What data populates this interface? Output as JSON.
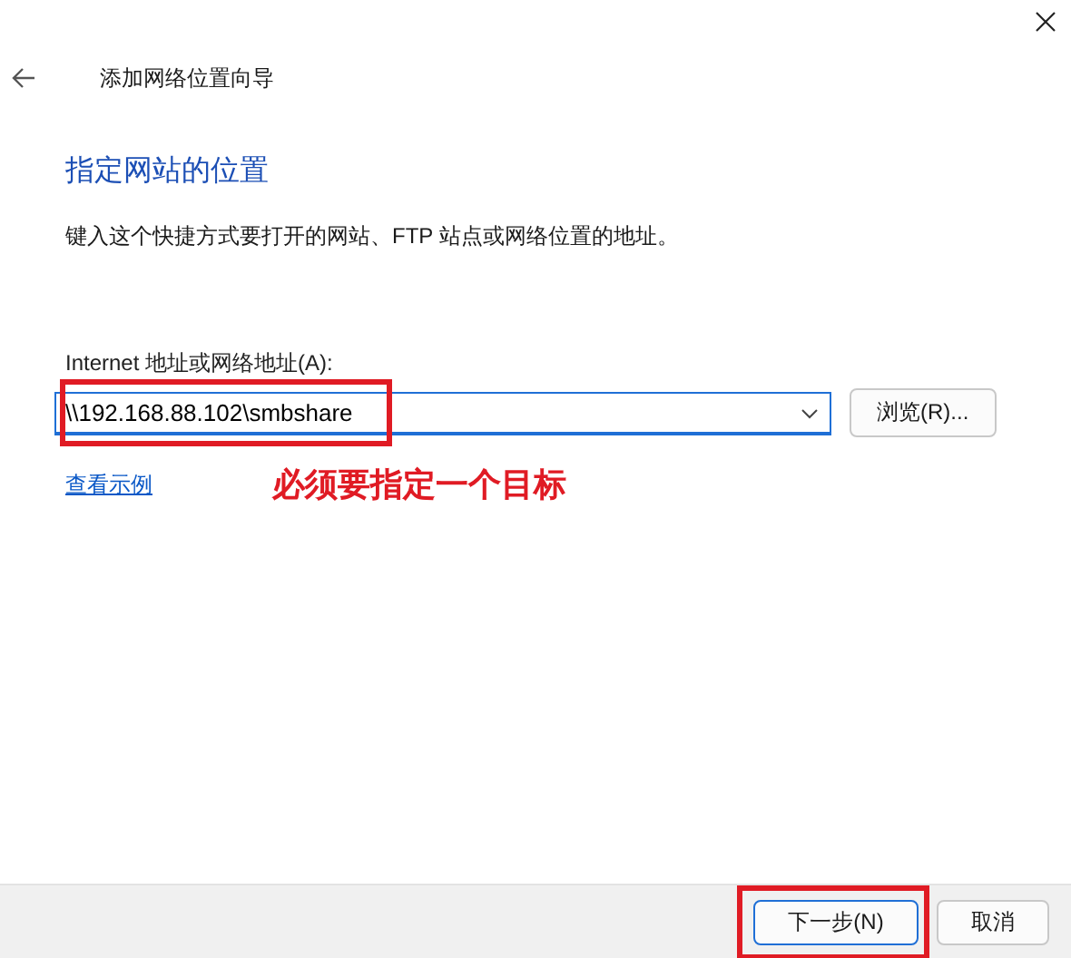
{
  "window": {
    "title": "添加网络位置向导"
  },
  "page": {
    "heading": "指定网站的位置",
    "description": "键入这个快捷方式要打开的网站、FTP 站点或网络位置的地址。"
  },
  "address": {
    "label": "Internet 地址或网络地址(A):",
    "value": "\\\\192.168.88.102\\smbshare",
    "highlighted": true
  },
  "browse_button": "浏览(R)...",
  "example_link": "查看示例",
  "annotation_note": "必须要指定一个目标",
  "buttons": [
    {
      "label": "下一步(N)",
      "default": true,
      "highlighted": true
    },
    {
      "label": "取消",
      "default": false,
      "highlighted": false
    }
  ]
}
